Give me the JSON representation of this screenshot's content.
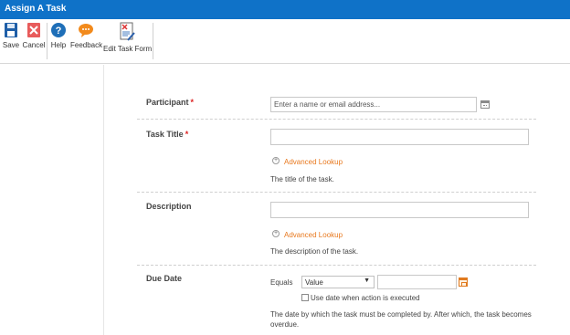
{
  "window": {
    "title": "Assign A Task"
  },
  "toolbar": {
    "save": "Save",
    "cancel": "Cancel",
    "help": "Help",
    "feedback": "Feedback",
    "edit_task_form": "Edit Task Form"
  },
  "form": {
    "participant": {
      "label": "Participant",
      "required_mark": "*",
      "placeholder": "Enter a name or email address..."
    },
    "task_title": {
      "label": "Task Title",
      "required_mark": "*",
      "value": "",
      "advanced_lookup": "Advanced Lookup",
      "help": "The title of the task."
    },
    "description": {
      "label": "Description",
      "value": "",
      "advanced_lookup": "Advanced Lookup",
      "help": "The description of the task."
    },
    "due_date": {
      "label": "Due Date",
      "operator": "Equals",
      "select_value": "Value",
      "date_value": "",
      "checkbox_label": "Use date when action is executed",
      "checkbox_checked": false,
      "help_line1": "The date by which the task must be completed by. After which, the task becomes",
      "help_line2": "overdue."
    }
  },
  "colors": {
    "titlebar": "#0f72c8",
    "link": "#e8791f",
    "required": "#dd2222"
  }
}
